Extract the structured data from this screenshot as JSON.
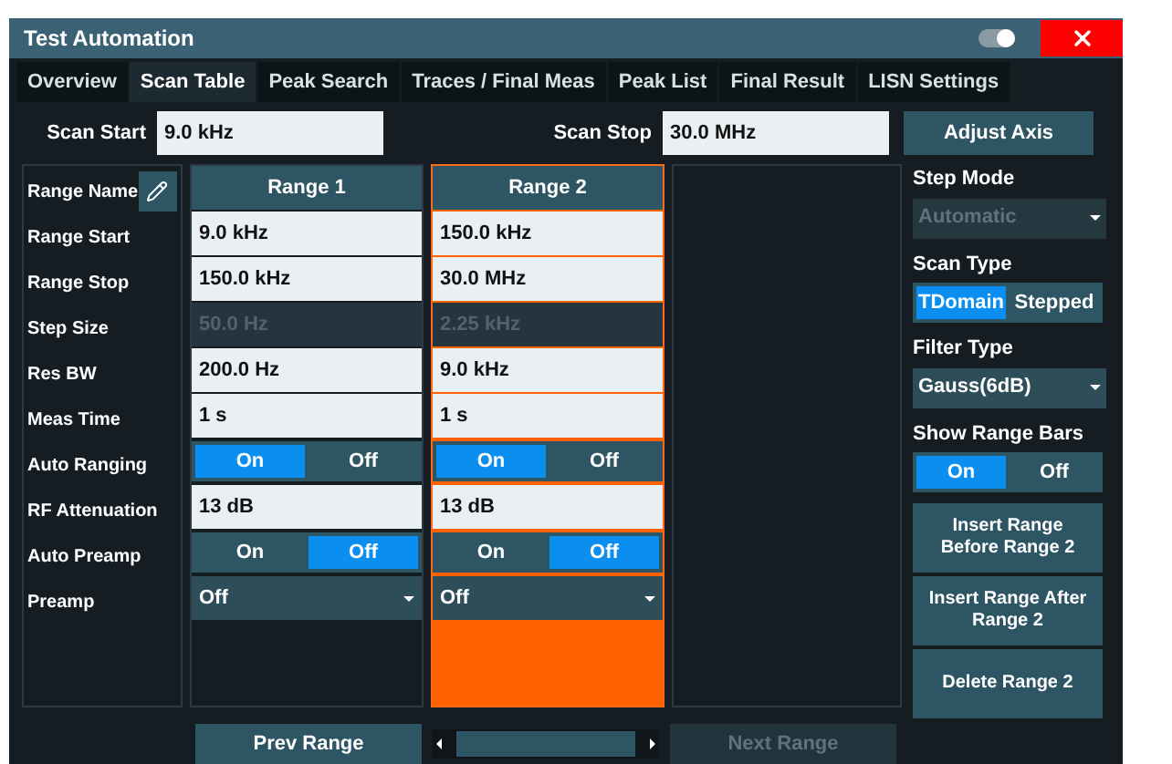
{
  "window": {
    "title": "Test Automation"
  },
  "tabs": [
    {
      "label": "Overview",
      "selected": false
    },
    {
      "label": "Scan Table",
      "selected": true
    },
    {
      "label": "Peak Search",
      "selected": false
    },
    {
      "label": "Traces / Final Meas",
      "selected": false
    },
    {
      "label": "Peak List",
      "selected": false
    },
    {
      "label": "Final Result",
      "selected": false
    },
    {
      "label": "LISN Settings",
      "selected": false
    }
  ],
  "scan_start": {
    "label": "Scan Start",
    "value": "9.0 kHz"
  },
  "scan_stop": {
    "label": "Scan Stop",
    "value": "30.0 MHz"
  },
  "adjust_axis": "Adjust Axis",
  "range_table": {
    "name_label": "Range Name",
    "row_labels": [
      "Range Start",
      "Range Stop",
      "Step Size",
      "Res BW",
      "Meas Time",
      "Auto Ranging",
      "RF Attenuation",
      "Auto Preamp",
      "Preamp"
    ],
    "ranges": [
      {
        "name": "Range 1",
        "selected": false,
        "cells": [
          {
            "kind": "field",
            "value": "9.0 kHz"
          },
          {
            "kind": "field",
            "value": "150.0 kHz"
          },
          {
            "kind": "readonly",
            "value": "50.0 Hz"
          },
          {
            "kind": "field",
            "value": "200.0 Hz"
          },
          {
            "kind": "field",
            "value": "1 s"
          },
          {
            "kind": "toggle",
            "options": [
              {
                "label": "On",
                "selected": true
              },
              {
                "label": "Off",
                "selected": false
              }
            ]
          },
          {
            "kind": "field",
            "value": "13 dB"
          },
          {
            "kind": "toggle",
            "options": [
              {
                "label": "On",
                "selected": false
              },
              {
                "label": "Off",
                "selected": true
              }
            ]
          },
          {
            "kind": "dropdown",
            "value": "Off"
          }
        ]
      },
      {
        "name": "Range 2",
        "selected": true,
        "cells": [
          {
            "kind": "field",
            "value": "150.0 kHz"
          },
          {
            "kind": "field",
            "value": "30.0 MHz"
          },
          {
            "kind": "readonly",
            "value": "2.25 kHz"
          },
          {
            "kind": "field",
            "value": "9.0 kHz"
          },
          {
            "kind": "field",
            "value": "1 s"
          },
          {
            "kind": "toggle",
            "options": [
              {
                "label": "On",
                "selected": true
              },
              {
                "label": "Off",
                "selected": false
              }
            ]
          },
          {
            "kind": "field",
            "value": "13 dB"
          },
          {
            "kind": "toggle",
            "options": [
              {
                "label": "On",
                "selected": false
              },
              {
                "label": "Off",
                "selected": true
              }
            ]
          },
          {
            "kind": "dropdown",
            "value": "Off"
          }
        ]
      }
    ]
  },
  "settings": [
    {
      "kind": "dropdown",
      "label": "Step Mode",
      "value": "Automatic",
      "disabled": true
    },
    {
      "kind": "toggle",
      "label": "Scan Type",
      "options": [
        {
          "label": "TDomain",
          "selected": true
        },
        {
          "label": "Stepped",
          "selected": false
        }
      ]
    },
    {
      "kind": "dropdown",
      "label": "Filter Type",
      "value": "Gauss(6dB)",
      "disabled": false
    },
    {
      "kind": "toggle",
      "label": "Show Range Bars",
      "options": [
        {
          "label": "On",
          "selected": true
        },
        {
          "label": "Off",
          "selected": false
        }
      ]
    }
  ],
  "actions": [
    "Insert Range Before Range 2",
    "Insert Range After Range 2",
    "Delete Range 2"
  ],
  "prev_range": {
    "label": "Prev Range",
    "disabled": false
  },
  "next_range": {
    "label": "Next Range",
    "disabled": true
  }
}
